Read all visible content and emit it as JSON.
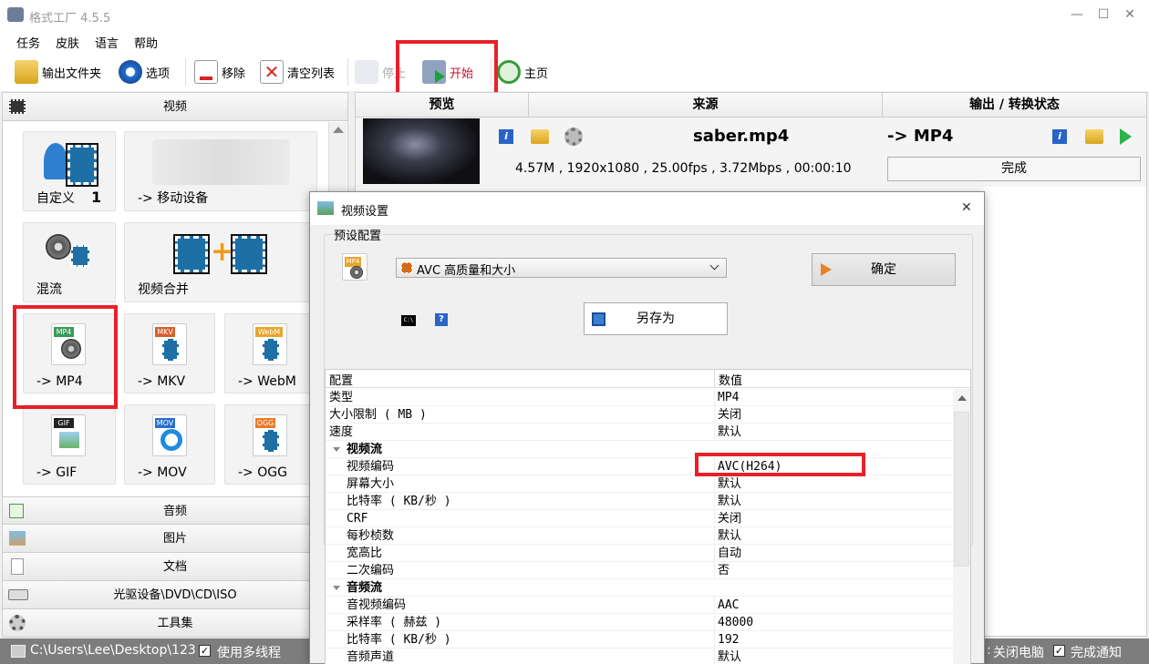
{
  "window": {
    "title": "格式工厂 4.5.5",
    "min": "—",
    "max": "☐",
    "close": "✕"
  },
  "menu": [
    "任务",
    "皮肤",
    "语言",
    "帮助"
  ],
  "toolbar": {
    "output_folder": "输出文件夹",
    "options": "选项",
    "remove": "移除",
    "clear_list": "清空列表",
    "stop": "停止",
    "start": "开始",
    "home": "主页"
  },
  "left": {
    "video_header": "视频",
    "tiles": {
      "custom": "自定义",
      "custom_badge": "1",
      "mobile": "-> 移动设备",
      "mux": "混流",
      "join": "视频合并",
      "mp4": "-> MP4",
      "mkv": "-> MKV",
      "webm": "-> WebM",
      "gif": "-> GIF",
      "mov": "-> MOV",
      "ogg": "-> OGG"
    },
    "icon_tags": {
      "mp4": "MP4",
      "mkv": "MKV",
      "webm": "WebM",
      "gif": "GIF",
      "mov": "MOV",
      "ogg": "OGG"
    },
    "categories": [
      "音频",
      "图片",
      "文档",
      "光驱设备\\DVD\\CD\\ISO",
      "工具集"
    ]
  },
  "list": {
    "col_preview": "预览",
    "col_source": "来源",
    "col_output": "输出 / 转换状态",
    "item": {
      "filename": "saber.mp4",
      "info": "4.57M , 1920x1080 , 25.00fps , 3.72Mbps , 00:00:10",
      "target": "-> MP4",
      "status": "完成"
    }
  },
  "status": {
    "path": "C:\\Users\\Lee\\Desktop\\123",
    "multithread": "使用多线程",
    "shutdown": "关闭电脑",
    "shutdown_prefix": ":",
    "notify": "完成通知",
    "checkmark": "✓"
  },
  "dialog": {
    "title": "视频设置",
    "close": "✕",
    "preset_group": "预设配置",
    "preset_value": "AVC 高质量和大小",
    "ok": "确定",
    "save_as": "另存为",
    "cmd_label": "C:\\",
    "help_label": "?",
    "icon_tag": "MP4",
    "grid_header": {
      "key": "配置",
      "value": "数值"
    },
    "rows": [
      {
        "k": "类型",
        "v": "MP4",
        "t": "n"
      },
      {
        "k": "大小限制 ( MB )",
        "v": "关闭",
        "t": "n"
      },
      {
        "k": "速度",
        "v": "默认",
        "t": "n"
      },
      {
        "k": "视频流",
        "v": "",
        "t": "s"
      },
      {
        "k": "视频编码",
        "v": "AVC(H264)",
        "t": "c"
      },
      {
        "k": "屏幕大小",
        "v": "默认",
        "t": "c"
      },
      {
        "k": "比特率 ( KB/秒 )",
        "v": "默认",
        "t": "c"
      },
      {
        "k": "CRF",
        "v": "关闭",
        "t": "c"
      },
      {
        "k": "每秒桢数",
        "v": "默认",
        "t": "c"
      },
      {
        "k": "宽高比",
        "v": "自动",
        "t": "c"
      },
      {
        "k": "二次编码",
        "v": "否",
        "t": "c"
      },
      {
        "k": "音频流",
        "v": "",
        "t": "s"
      },
      {
        "k": "音视频编码",
        "v": "AAC",
        "t": "c"
      },
      {
        "k": "采样率 ( 赫兹 )",
        "v": "48000",
        "t": "c"
      },
      {
        "k": "比特率 ( KB/秒 )",
        "v": "192",
        "t": "c"
      },
      {
        "k": "音频声道",
        "v": "默认",
        "t": "c"
      }
    ]
  },
  "colors": {
    "highlight": "#e8202a",
    "accent": "#1d6fa5"
  }
}
